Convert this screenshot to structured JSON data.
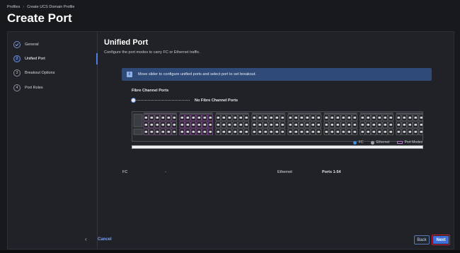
{
  "breadcrumb": {
    "items": [
      "Profiles",
      "Create UCS Domain Profile"
    ],
    "separator": "›"
  },
  "page_title": "Create Port",
  "steps": [
    {
      "num": "1",
      "label": "General",
      "state": "done"
    },
    {
      "num": "2",
      "label": "Unified Port",
      "state": "active"
    },
    {
      "num": "3",
      "label": "Breakout Options",
      "state": "pending"
    },
    {
      "num": "4",
      "label": "Port Roles",
      "state": "pending"
    }
  ],
  "content": {
    "title": "Unified Port",
    "subtitle": "Configure the port modes to carry FC or Ethernet traffic.",
    "info_banner": "Move slider to configure unified ports and select port to set breakout.",
    "fc_ports_label": "Fibre Channel Ports",
    "slider_value_text": "No Fibre Channel Ports",
    "slider_fraction": 0
  },
  "legend": [
    {
      "label": "FC",
      "color": "#3d8fe0",
      "shape": "dot"
    },
    {
      "label": "Ethernet",
      "color": "#9aa0a8",
      "shape": "dot"
    },
    {
      "label": "Port Modes",
      "color": "#b574c8",
      "shape": "box"
    }
  ],
  "summary": {
    "fc_label": "FC",
    "fc_value": "-",
    "eth_label": "Ethernet",
    "eth_value": "Ports 1-54"
  },
  "footer": {
    "cancel": "Cancel",
    "back": "Back",
    "next": "Next"
  },
  "icons": {
    "info": "info-icon",
    "collapse": "chevron-left-icon",
    "step_done": "check-icon"
  },
  "colors": {
    "accent": "#3f6fd8",
    "highlight_border": "#d01f32",
    "banner": "#2f4a76"
  }
}
